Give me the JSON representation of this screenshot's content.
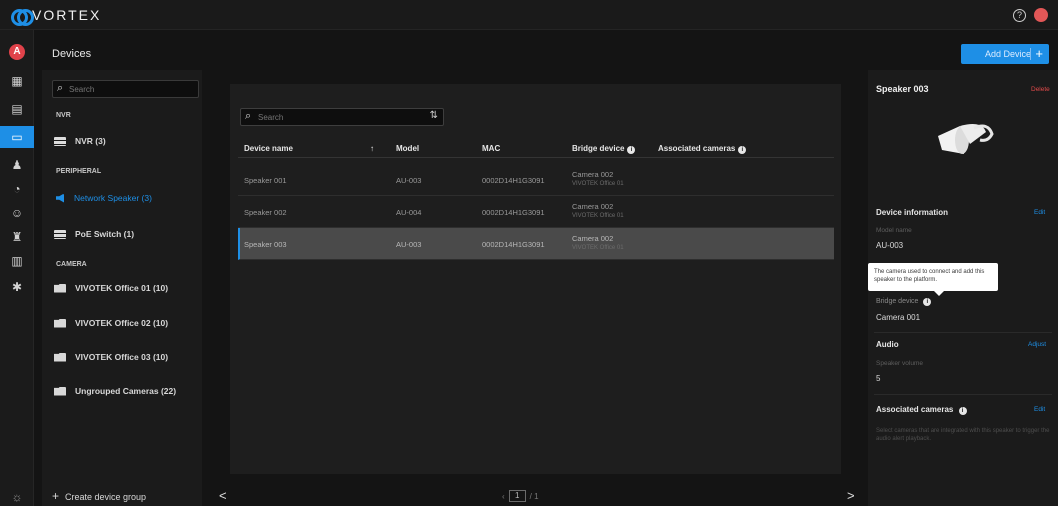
{
  "app": {
    "name": "VORTEX",
    "help_glyph": "?"
  },
  "rail": {
    "avatar_letter": "A",
    "items": [
      {
        "name": "dashboard-icon",
        "glyph": "▦",
        "active": false
      },
      {
        "name": "layout-icon",
        "glyph": "▤",
        "active": false
      },
      {
        "name": "devices-icon",
        "glyph": "▭",
        "active": true
      },
      {
        "name": "users-icon",
        "glyph": "♟",
        "active": false
      },
      {
        "name": "tag-icon",
        "glyph": "◔",
        "active": false
      },
      {
        "name": "face-icon",
        "glyph": "☺",
        "active": false
      },
      {
        "name": "alarm-icon",
        "glyph": "♜",
        "active": false
      },
      {
        "name": "storage-icon",
        "glyph": "▥",
        "active": false
      },
      {
        "name": "settings-icon",
        "glyph": "✱",
        "active": false
      }
    ],
    "theme_glyph": "☼"
  },
  "page": {
    "title": "Devices",
    "add_device_label": "Add Device",
    "add_plus": "+"
  },
  "groups": {
    "search_placeholder": "Search",
    "sections": {
      "nvr": "NVR",
      "peripheral": "PERIPHERAL",
      "camera": "CAMERA"
    },
    "items": {
      "nvr": "NVR (3)",
      "speaker": "Network Speaker (3)",
      "poe": "PoE Switch (1)",
      "cam1": "VIVOTEK Office 01 (10)",
      "cam2": "VIVOTEK Office 02 (10)",
      "cam3": "VIVOTEK Office 03 (10)",
      "ungrouped": "Ungrouped Cameras (22)"
    },
    "create_label": "Create device group",
    "create_plus": "+"
  },
  "table": {
    "search_placeholder": "Search",
    "filter_glyph": "⇅",
    "columns": {
      "name": "Device name",
      "sort": "↑",
      "model": "Model",
      "mac": "MAC",
      "bridge": "Bridge device",
      "assoc": "Associated cameras",
      "info_glyph": "i"
    },
    "rows": [
      {
        "name": "Speaker 001",
        "model": "AU-003",
        "mac": "0002D14H1G3091",
        "bridge": "Camera 002",
        "bridge_sub": "VIVOTEK Office 01",
        "selected": false
      },
      {
        "name": "Speaker 002",
        "model": "AU-004",
        "mac": "0002D14H1G3091",
        "bridge": "Camera 002",
        "bridge_sub": "VIVOTEK Office 01",
        "selected": false
      },
      {
        "name": "Speaker 003",
        "model": "AU-003",
        "mac": "0002D14H1G3091",
        "bridge": "Camera 002",
        "bridge_sub": "VIVOTEK Office 01",
        "selected": true
      }
    ],
    "pager": {
      "current": "1",
      "total": "/ 1",
      "prev": "‹",
      "next": "›",
      "arrow_left": "<",
      "arrow_right": ">"
    }
  },
  "detail": {
    "title": "Speaker 003",
    "delete_label": "Delete",
    "device_info_title": "Device information",
    "edit_label": "Edit",
    "model_label": "Model name",
    "model_value": "AU-003",
    "tooltip": "The camera used to connect and add this speaker to the platform.",
    "bridge_label": "Bridge device",
    "bridge_value": "Camera 001",
    "audio_title": "Audio",
    "audio_edit": "Adjust",
    "speaker_volume_label": "Speaker volume",
    "speaker_volume_value": "5",
    "assoc_title": "Associated cameras",
    "assoc_edit": "Edit",
    "assoc_text": "Select cameras that are integrated with this speaker to trigger the audio alert playback.",
    "info_glyph": "i"
  },
  "colors": {
    "accent": "#1e8fe6",
    "danger": "#e24a4a",
    "bg": "#141414",
    "panel": "#1b1b1b"
  }
}
